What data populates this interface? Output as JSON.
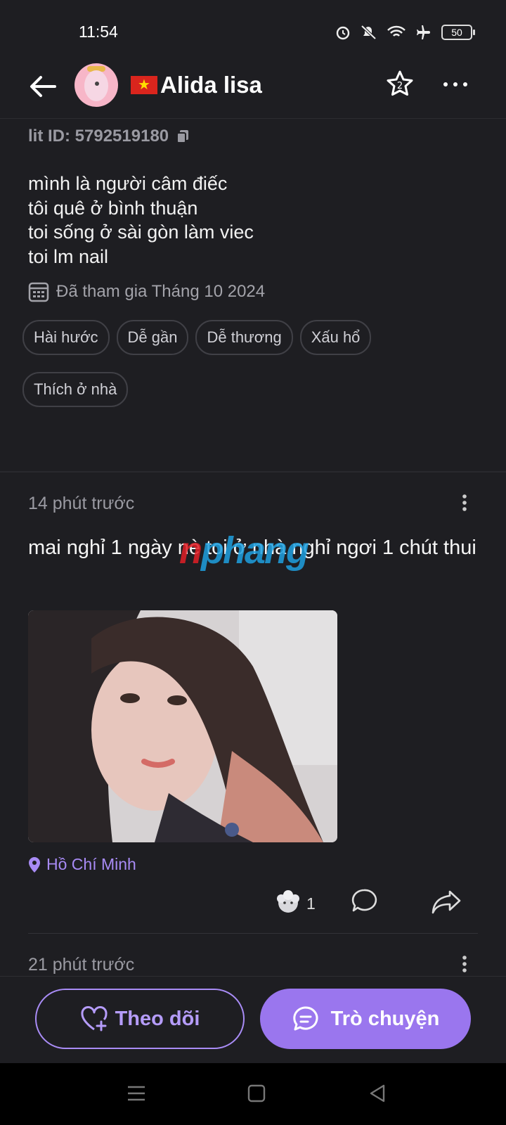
{
  "status_bar": {
    "time": "11:54",
    "battery": "50"
  },
  "header": {
    "name": "Alida lisa",
    "flag_icon": "vietnam-flag-icon"
  },
  "profile": {
    "lit_id": "lit ID: 5792519180",
    "bio": [
      "mình là người câm điếc",
      "tôi quê ở bình thuận",
      "toi sống ở sài gòn làm viec",
      "toi lm nail"
    ],
    "joined": "Đã tham gia Tháng 10 2024",
    "tags": [
      "Hài hước",
      "Dễ gần",
      "Dễ thương",
      "Xấu hổ",
      "Thích ở nhà"
    ]
  },
  "post": {
    "time": "14 phút trước",
    "text": "mai nghỉ 1 ngày nè toi ở nhà nghỉ ngơi 1 chút thui",
    "location": "Hồ Chí Minh",
    "like_count": "1",
    "watermark_a": "n",
    "watermark_b": "phang"
  },
  "post2": {
    "time": "21 phút trước"
  },
  "bottom": {
    "follow_label": "Theo dõi",
    "chat_label": "Trò chuyện"
  },
  "colors": {
    "accent": "#9a76ee",
    "background": "#1e1e22",
    "location": "#a88bf5"
  }
}
